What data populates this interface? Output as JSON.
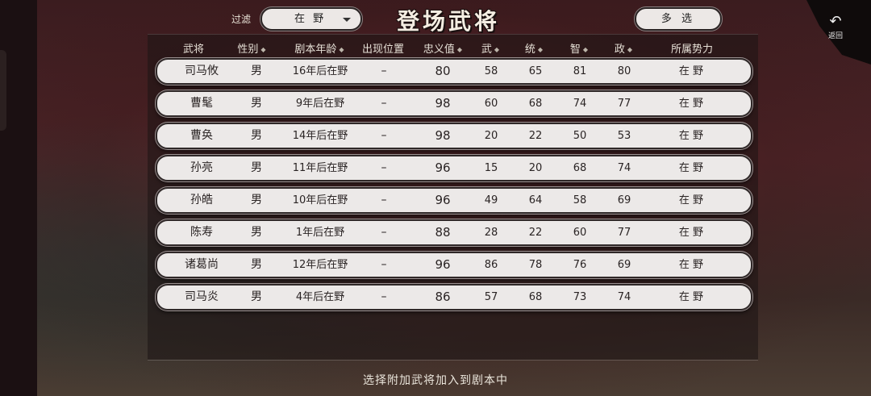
{
  "filter": {
    "label": "过滤",
    "value": "在 野"
  },
  "title": "登场武将",
  "multi_select_label": "多 选",
  "back": {
    "label": "返回",
    "icon": "undo-arrow-icon"
  },
  "columns": [
    {
      "label": "武将",
      "sortable": false
    },
    {
      "label": "性别",
      "sortable": true
    },
    {
      "label": "剧本年龄",
      "sortable": true
    },
    {
      "label": "出现位置",
      "sortable": false
    },
    {
      "label": "忠义值",
      "sortable": true
    },
    {
      "label": "武",
      "sortable": true
    },
    {
      "label": "统",
      "sortable": true
    },
    {
      "label": "智",
      "sortable": true
    },
    {
      "label": "政",
      "sortable": true
    },
    {
      "label": "所属势力",
      "sortable": false
    }
  ],
  "sort_glyph": "◆",
  "rows": [
    {
      "name": "司马攸",
      "gender": "男",
      "age": "16年后在野",
      "location": "–",
      "loyalty": "80",
      "war": "58",
      "lead": "65",
      "intel": "81",
      "pol": "80",
      "faction": "在 野"
    },
    {
      "name": "曹髦",
      "gender": "男",
      "age": "9年后在野",
      "location": "–",
      "loyalty": "98",
      "war": "60",
      "lead": "68",
      "intel": "74",
      "pol": "77",
      "faction": "在 野"
    },
    {
      "name": "曹奂",
      "gender": "男",
      "age": "14年后在野",
      "location": "–",
      "loyalty": "98",
      "war": "20",
      "lead": "22",
      "intel": "50",
      "pol": "53",
      "faction": "在 野"
    },
    {
      "name": "孙亮",
      "gender": "男",
      "age": "11年后在野",
      "location": "–",
      "loyalty": "96",
      "war": "15",
      "lead": "20",
      "intel": "68",
      "pol": "74",
      "faction": "在 野"
    },
    {
      "name": "孙皓",
      "gender": "男",
      "age": "10年后在野",
      "location": "–",
      "loyalty": "96",
      "war": "49",
      "lead": "64",
      "intel": "58",
      "pol": "69",
      "faction": "在 野"
    },
    {
      "name": "陈寿",
      "gender": "男",
      "age": "1年后在野",
      "location": "–",
      "loyalty": "88",
      "war": "28",
      "lead": "22",
      "intel": "60",
      "pol": "77",
      "faction": "在 野"
    },
    {
      "name": "诸葛尚",
      "gender": "男",
      "age": "12年后在野",
      "location": "–",
      "loyalty": "96",
      "war": "86",
      "lead": "78",
      "intel": "76",
      "pol": "69",
      "faction": "在 野"
    },
    {
      "name": "司马炎",
      "gender": "男",
      "age": "4年后在野",
      "location": "–",
      "loyalty": "86",
      "war": "57",
      "lead": "68",
      "intel": "73",
      "pol": "74",
      "faction": "在 野"
    }
  ],
  "footer": "选择附加武将加入到剧本中"
}
